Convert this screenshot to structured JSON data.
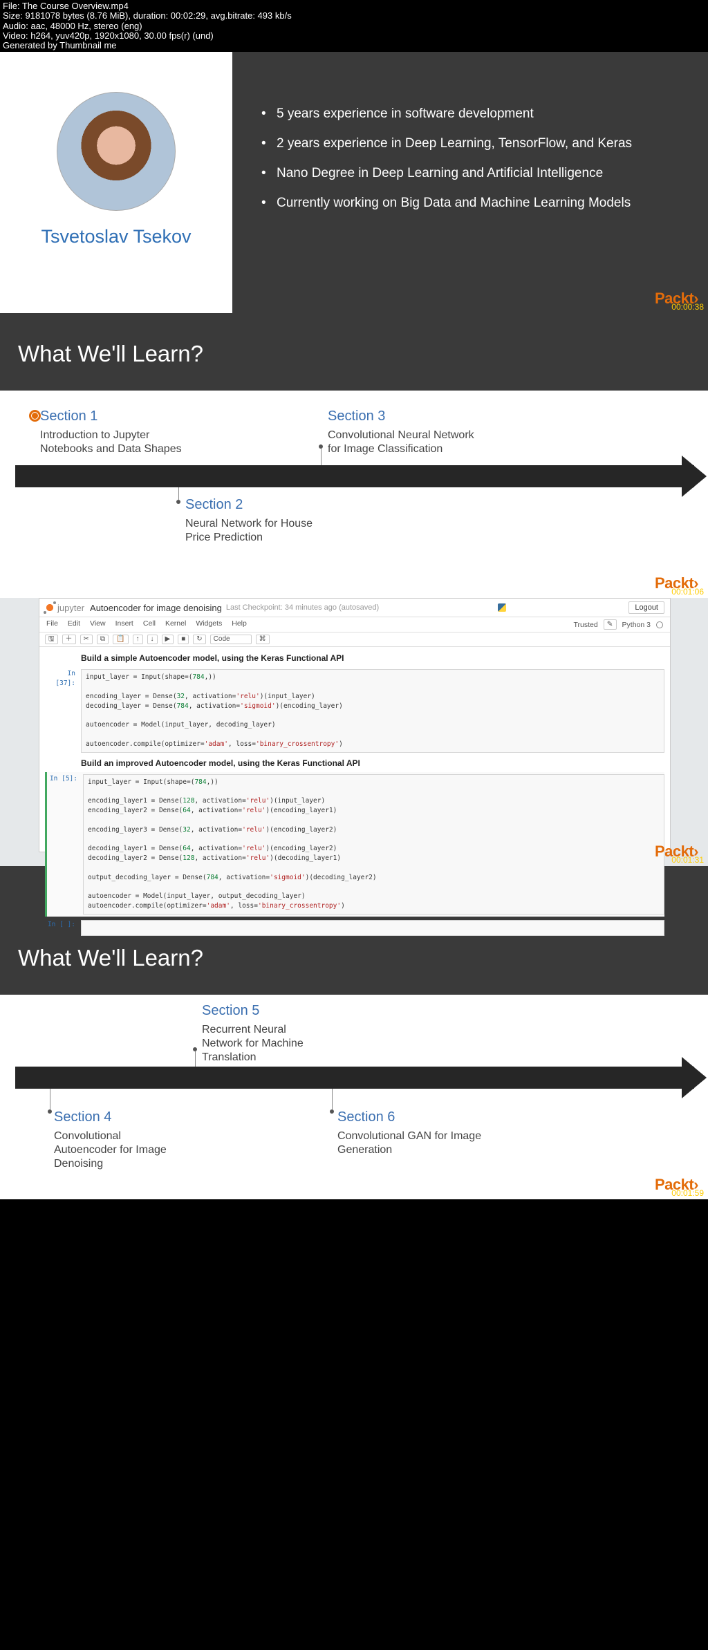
{
  "meta": {
    "file": "File: The Course Overview.mp4",
    "size": "Size: 9181078 bytes (8.76 MiB), duration: 00:02:29, avg.bitrate: 493 kb/s",
    "audio": "Audio: aac, 48000 Hz, stereo (eng)",
    "video": "Video: h264, yuv420p, 1920x1080, 30.00 fps(r) (und)",
    "gen": "Generated by Thumbnail me"
  },
  "brand": "Packt",
  "slide1": {
    "author": "Tsvetoslav Tsekov",
    "bullets": [
      "5 years experience in software development",
      "2 years experience in Deep Learning, TensorFlow, and Keras",
      "Nano Degree in Deep Learning and Artificial Intelligence",
      "Currently working on Big Data and Machine Learning Models"
    ],
    "time": "00:00:38"
  },
  "slide2": {
    "title": "What We'll Learn?",
    "sec1": {
      "h": "Section 1",
      "p": "Introduction to Jupyter Notebooks and Data Shapes"
    },
    "sec2": {
      "h": "Section 2",
      "p": "Neural Network for House Price Prediction"
    },
    "sec3": {
      "h": "Section 3",
      "p": "Convolutional Neural Network for Image Classification"
    },
    "time": "00:01:06"
  },
  "jup": {
    "brand": "jupyter",
    "title": "Autoencoder for image denoising",
    "checkpoint": "Last Checkpoint: 34 minutes ago (autosaved)",
    "logout": "Logout",
    "menus": {
      "file": "File",
      "edit": "Edit",
      "view": "View",
      "insert": "Insert",
      "cell": "Cell",
      "kernel": "Kernel",
      "widgets": "Widgets",
      "help": "Help",
      "trusted": "Trusted",
      "kernel_name": "Python 3"
    },
    "toolbar_sel": "Code",
    "h1": "Build a simple Autoencoder model, using the Keras Functional API",
    "prompt1": "In [37]:",
    "code1": "input_layer = Input(shape=(784,))\n\nencoding_layer = Dense(32, activation='relu')(input_layer)\ndecoding_layer = Dense(784, activation='sigmoid')(encoding_layer)\n\nautoencoder = Model(input_layer, decoding_layer)\n\nautoencoder.compile(optimizer='adam', loss='binary_crossentropy')",
    "h2": "Build an improved Autoencoder model, using the Keras Functional API",
    "prompt2": "In [5]:",
    "code2": "input_layer = Input(shape=(784,))\n\nencoding_layer1 = Dense(128, activation='relu')(input_layer)\nencoding_layer2 = Dense(64, activation='relu')(encoding_layer1)\n\nencoding_layer3 = Dense(32, activation='relu')(encoding_layer2)\n\ndecoding_layer1 = Dense(64, activation='relu')(encoding_layer2)\ndecoding_layer2 = Dense(128, activation='relu')(decoding_layer1)\n\noutput_decoding_layer = Dense(784, activation='sigmoid')(decoding_layer2)\n\nautoencoder = Model(input_layer, output_decoding_layer)\nautoencoder.compile(optimizer='adam', loss='binary_crossentropy')",
    "prompt3": "In [ ]:",
    "time": "00:01:31"
  },
  "slide4": {
    "title": "What We'll Learn?",
    "sec4": {
      "h": "Section 4",
      "p": "Convolutional Autoencoder for Image Denoising"
    },
    "sec5": {
      "h": "Section 5",
      "p": "Recurrent Neural Network for Machine Translation"
    },
    "sec6": {
      "h": "Section 6",
      "p": "Convolutional GAN for Image Generation"
    },
    "time": "00:01:59"
  }
}
